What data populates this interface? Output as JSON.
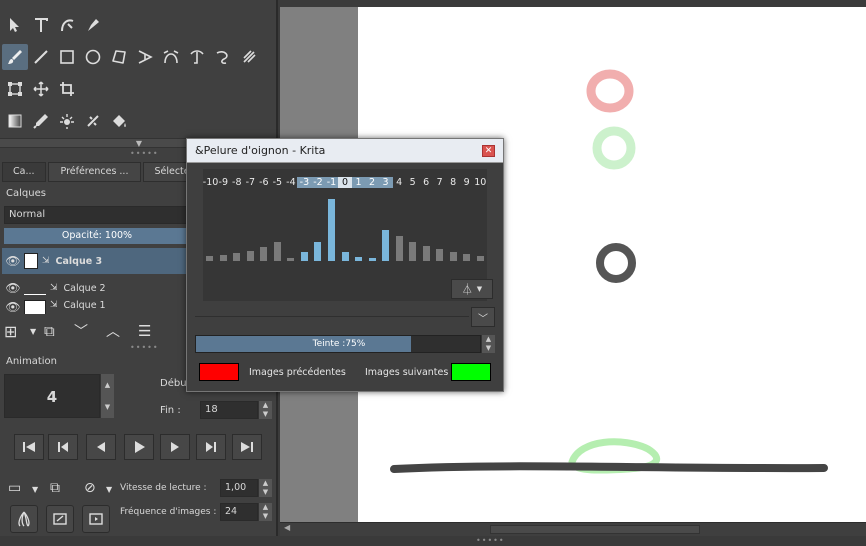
{
  "toolbox": {
    "rows": [
      [
        "select-icon",
        "text-icon",
        "calligraphy-icon",
        "vector-edit-icon"
      ],
      [
        "brush-icon",
        "line-icon",
        "rectangle-icon",
        "ellipse-icon",
        "polygon-icon",
        "polyline-icon",
        "bezier-icon",
        "path-icon",
        "freehand-path-icon",
        "multibrush-icon"
      ],
      [
        "transform-icon",
        "move-icon",
        "crop-icon"
      ],
      [
        "gradient-icon",
        "color-picker-icon",
        "smart-patch-icon",
        "assistant-icon",
        "fill-icon"
      ]
    ]
  },
  "docker_tabs": [
    "Ca...",
    "Préférences ...",
    "Sélecteur"
  ],
  "layers": {
    "title": "Calques",
    "blend_mode": "Normal",
    "opacity_label": "Opacité:  100%",
    "items": [
      {
        "name": "Calque 3",
        "selected": true
      },
      {
        "name": "Calque 2",
        "selected": false
      },
      {
        "name": "Calque 1",
        "selected": false
      }
    ]
  },
  "animation": {
    "title": "Animation",
    "current_frame": "4",
    "start_label": "Début",
    "end_label": "Fin :",
    "end_value": "18",
    "speed_label": "Vitesse de lecture :",
    "speed_value": "1,00",
    "fps_label": "Fréquence d'images :",
    "fps_value": "24"
  },
  "onion": {
    "title": "&Pelure d'oignon - Krita",
    "close_glyph": "✕",
    "frames": [
      "-10",
      "-9",
      "-8",
      "-7",
      "-6",
      "-5",
      "-4",
      "-3",
      "-2",
      "-1",
      "0",
      "1",
      "2",
      "3",
      "4",
      "5",
      "6",
      "7",
      "8",
      "9",
      "10"
    ],
    "enabled_frames": [
      "-3",
      "-2",
      "-1",
      "1",
      "2",
      "3"
    ],
    "current": "0",
    "opacity_fractions": [
      0.08,
      0.1,
      0.13,
      0.16,
      0.22,
      0.3,
      0.05,
      0.14,
      0.3,
      1.0,
      0.14,
      0.07,
      0.05,
      0.5,
      0.4,
      0.3,
      0.25,
      0.2,
      0.15,
      0.12,
      0.08
    ],
    "tint_label": "Teinte :75%",
    "tint_fraction": 0.75,
    "prev_label": "Images précédentes",
    "next_label": "Images suivantes",
    "prev_color": "#ff0000",
    "next_color": "#00ff00"
  },
  "colors": {
    "accent": "#5b7893",
    "selected_layer": "#4e677e",
    "canvas_bg": "#808080",
    "paper": "#ffffff"
  }
}
